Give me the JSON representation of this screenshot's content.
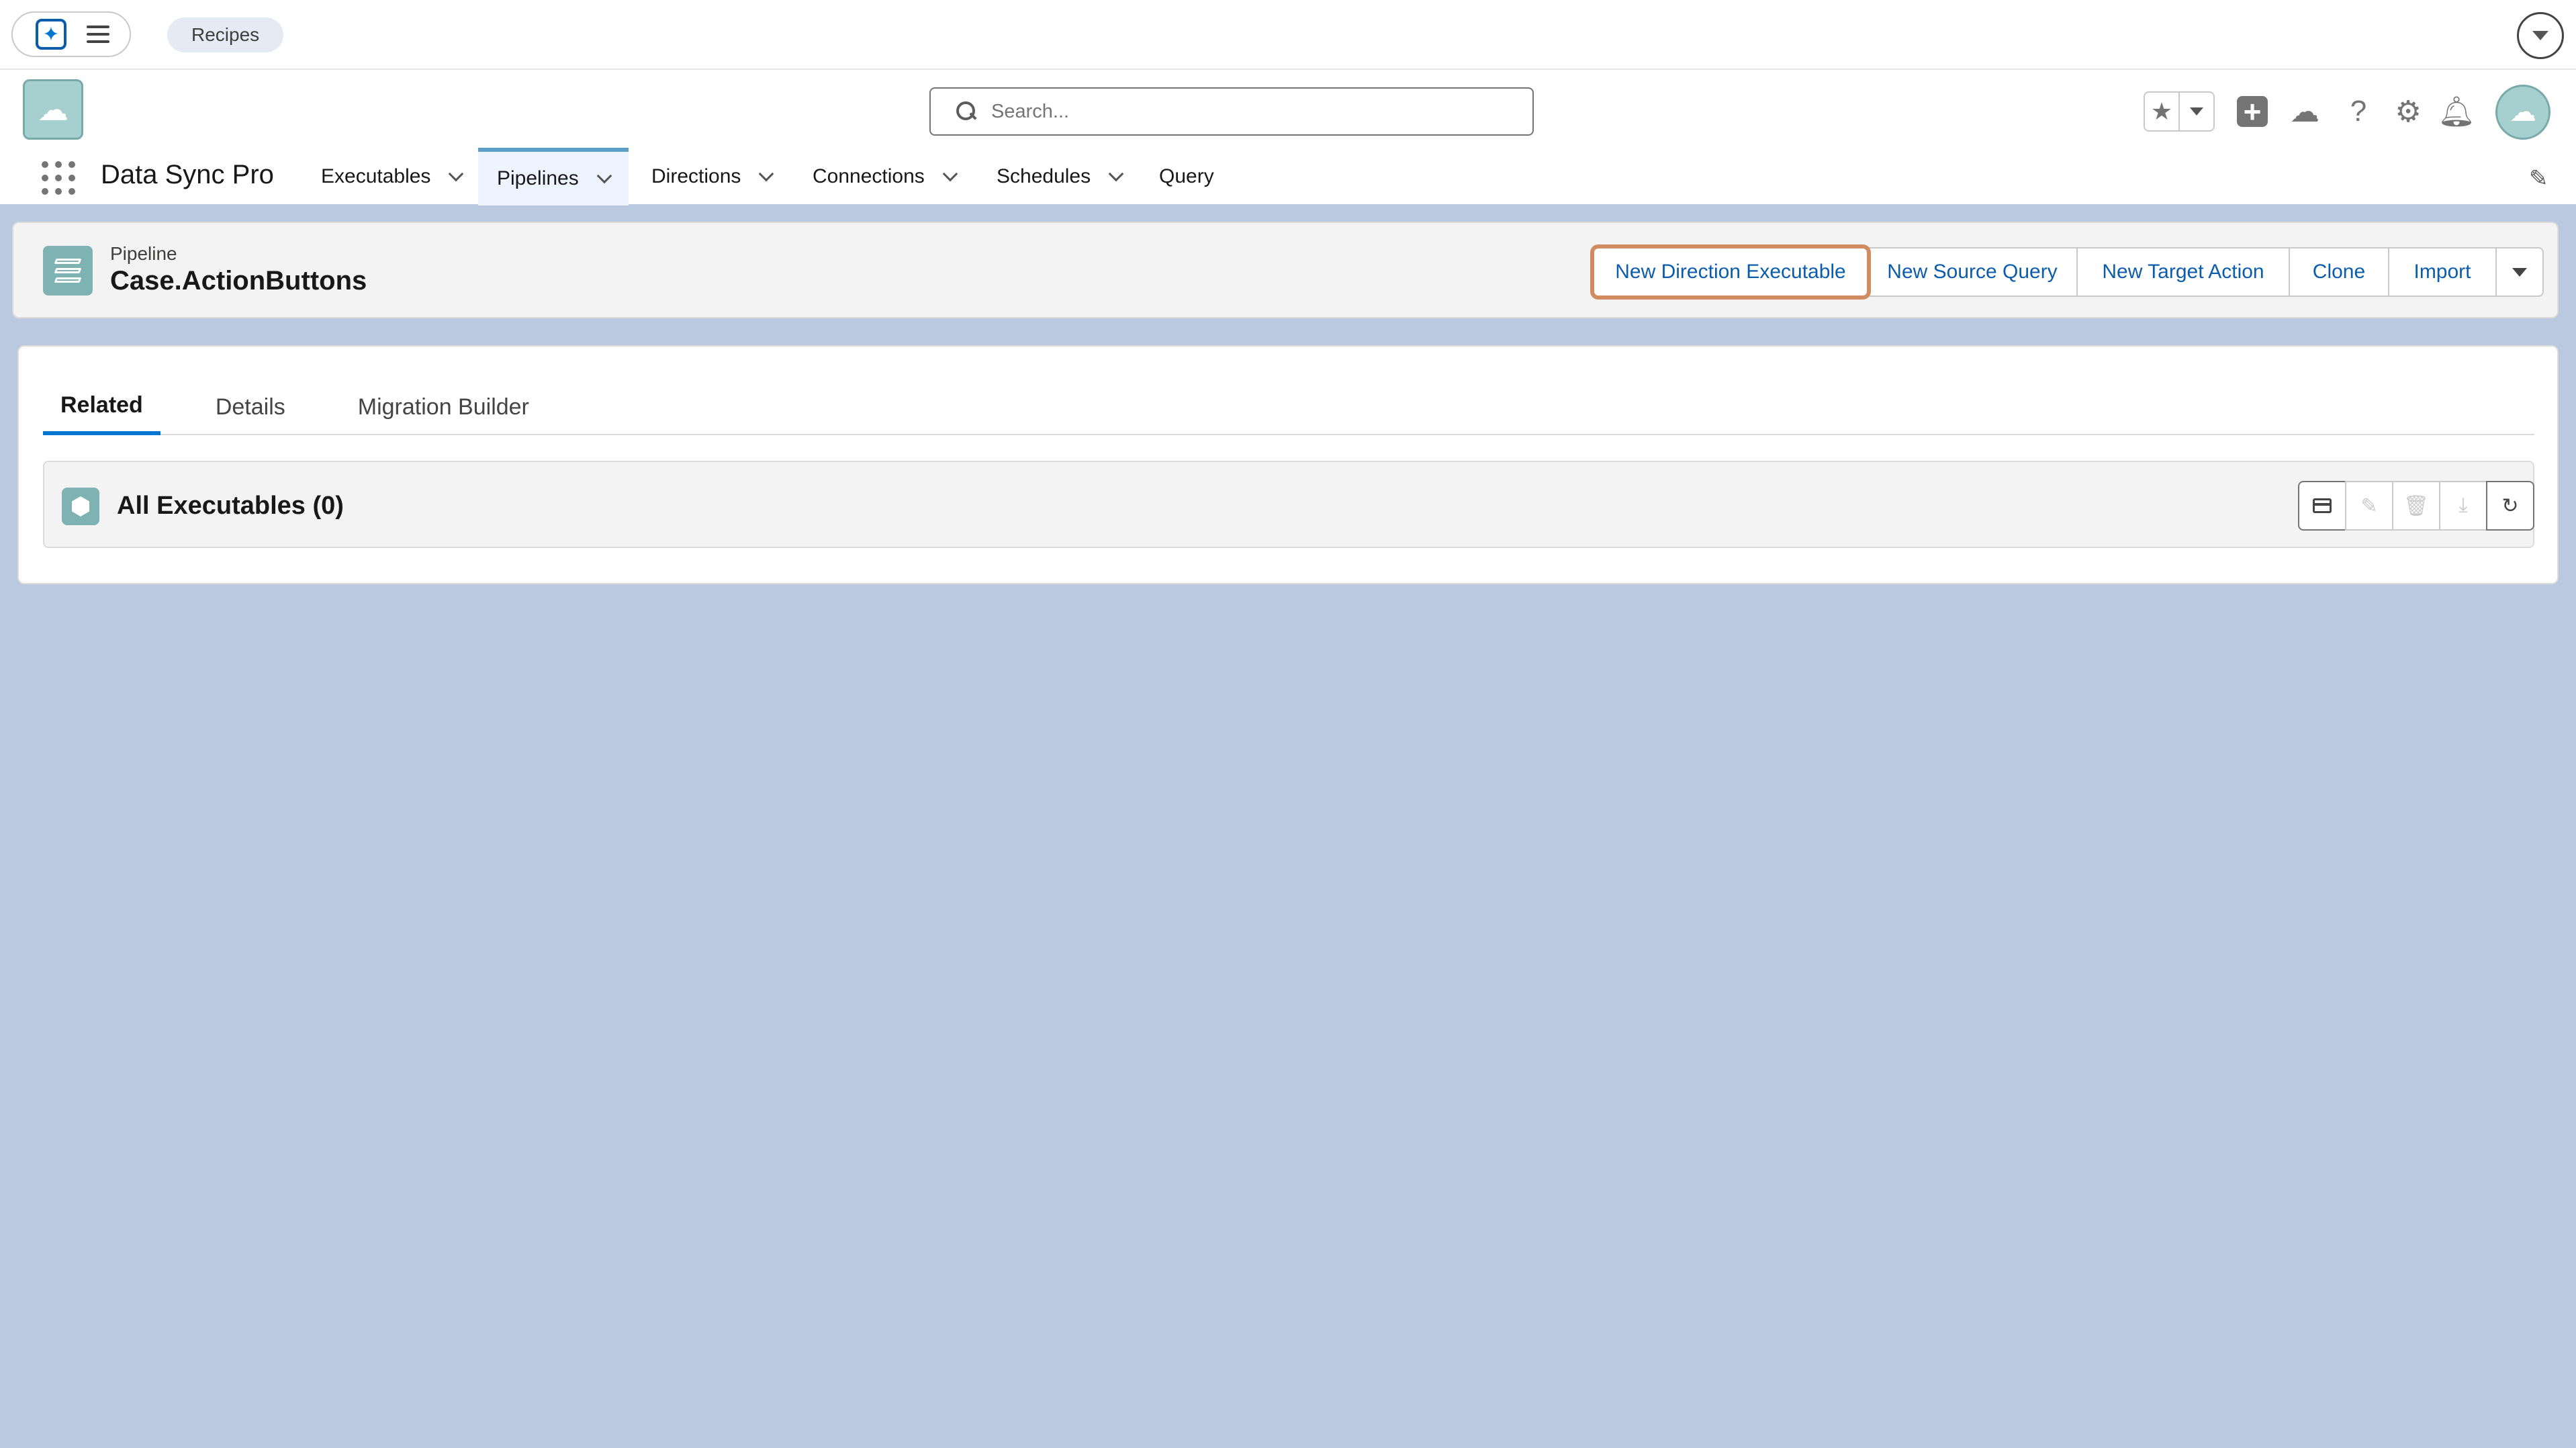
{
  "topbar": {
    "recipes_label": "Recipes"
  },
  "header": {
    "search_placeholder": "Search...",
    "app_name": "Data Sync Pro",
    "nav": [
      {
        "label": "Executables",
        "has_menu": true
      },
      {
        "label": "Pipelines",
        "has_menu": true,
        "active": true
      },
      {
        "label": "Directions",
        "has_menu": true
      },
      {
        "label": "Connections",
        "has_menu": true
      },
      {
        "label": "Schedules",
        "has_menu": true
      },
      {
        "label": "Query",
        "has_menu": false
      }
    ]
  },
  "record": {
    "type_label": "Pipeline",
    "title": "Case.ActionButtons",
    "actions": [
      "New Direction Executable",
      "New Source Query",
      "New Target Action",
      "Clone",
      "Import"
    ]
  },
  "tabs": [
    {
      "label": "Related",
      "active": true
    },
    {
      "label": "Details"
    },
    {
      "label": "Migration Builder"
    }
  ],
  "related_list": {
    "title": "All Executables (0)"
  },
  "colors": {
    "brand": "#0176d3",
    "link": "#0b5cab",
    "focus_outline": "#d08c60",
    "page_bg": "#bac9e0",
    "object_icon": "#7fb2b2"
  },
  "icons": {
    "launcher": "sparkle-icon",
    "menu": "hamburger-icon",
    "search": "search-icon",
    "favorites": "star-icon",
    "global_actions": "plus-icon",
    "trailhead": "cloud-icon",
    "help": "help-icon",
    "setup": "gear-icon",
    "notifications": "bell-icon",
    "edit_nav": "pencil-icon",
    "record": "layers-icon",
    "related": "hexagon-icon"
  }
}
